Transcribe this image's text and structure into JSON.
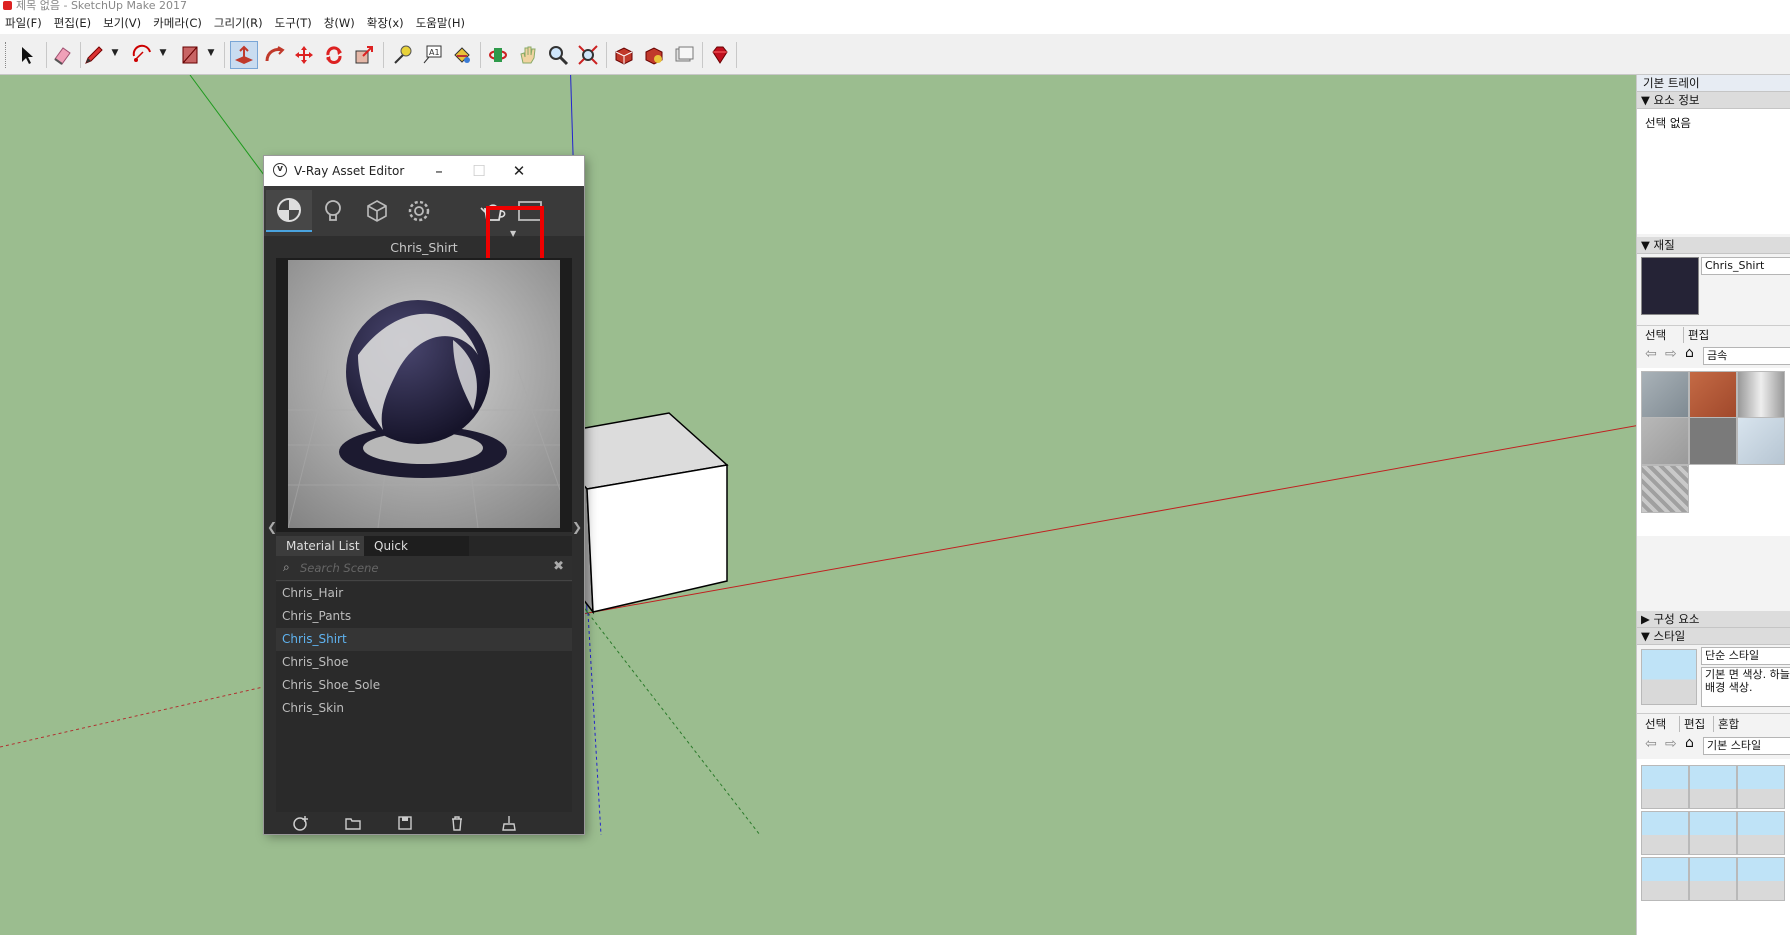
{
  "window": {
    "title": "제목 없음 - SketchUp Make 2017"
  },
  "menu": [
    "파일(F)",
    "편집(E)",
    "보기(V)",
    "카메라(C)",
    "그리기(R)",
    "도구(T)",
    "창(W)",
    "확장(x)",
    "도움말(H)"
  ],
  "toolbar": {
    "tools": [
      "select-icon",
      "eraser-icon",
      "pencil-icon",
      "arc-icon",
      "rectangle-icon",
      "push-pull-icon",
      "follow-me-icon",
      "move-icon",
      "rotate-icon",
      "scale-icon",
      "tape-measure-icon",
      "text-icon",
      "paint-bucket-icon",
      "orbit-icon",
      "pan-icon",
      "zoom-icon",
      "zoom-extents-icon",
      "warehouse-icon",
      "extension-warehouse-icon",
      "layout-icon",
      "ruby-icon"
    ],
    "active_tool": "push-pull-icon",
    "text_tool_label": "A1"
  },
  "vray": {
    "title": "V-Ray Asset Editor",
    "tabs": [
      "materials-tab-icon",
      "lights-tab-icon",
      "geometry-tab-icon",
      "settings-tab-icon",
      "teapot-render-icon",
      "frame-buffer-icon"
    ],
    "selected_material": "Chris_Shirt",
    "list_tab_label": "Material List",
    "settings_tab_label": "Quick Settings",
    "search_placeholder": "Search Scene",
    "materials": [
      "Chris_Hair",
      "Chris_Pants",
      "Chris_Shirt",
      "Chris_Shoe",
      "Chris_Shoe_Sole",
      "Chris_Skin"
    ],
    "bottom_icons": [
      "add-material-icon",
      "open-folder-icon",
      "save-icon",
      "delete-icon",
      "purge-icon"
    ],
    "highlight_color": "#e00000",
    "accent_color": "#5fb3f0"
  },
  "tray": {
    "title": "기본 트레이",
    "entity_info": {
      "header": "요소 정보",
      "text": "선택 없음"
    },
    "materials": {
      "header": "재질",
      "name": "Chris_Shirt",
      "tab_select": "선택",
      "tab_edit": "편집",
      "library": "금속"
    },
    "components": {
      "header": "구성 요소"
    },
    "styles": {
      "header": "스타일",
      "name": "단순 스타일",
      "desc": "기본 면 색상. 하늘/배경 색상.",
      "tab_select": "선택",
      "tab_edit": "편집",
      "tab_mix": "혼합",
      "library": "기본 스타일"
    }
  },
  "colors": {
    "viewport_bg": "#9bbd8f",
    "axis_blue": "#2323d0",
    "axis_red": "#c02020",
    "axis_green": "#1f9a1f"
  }
}
